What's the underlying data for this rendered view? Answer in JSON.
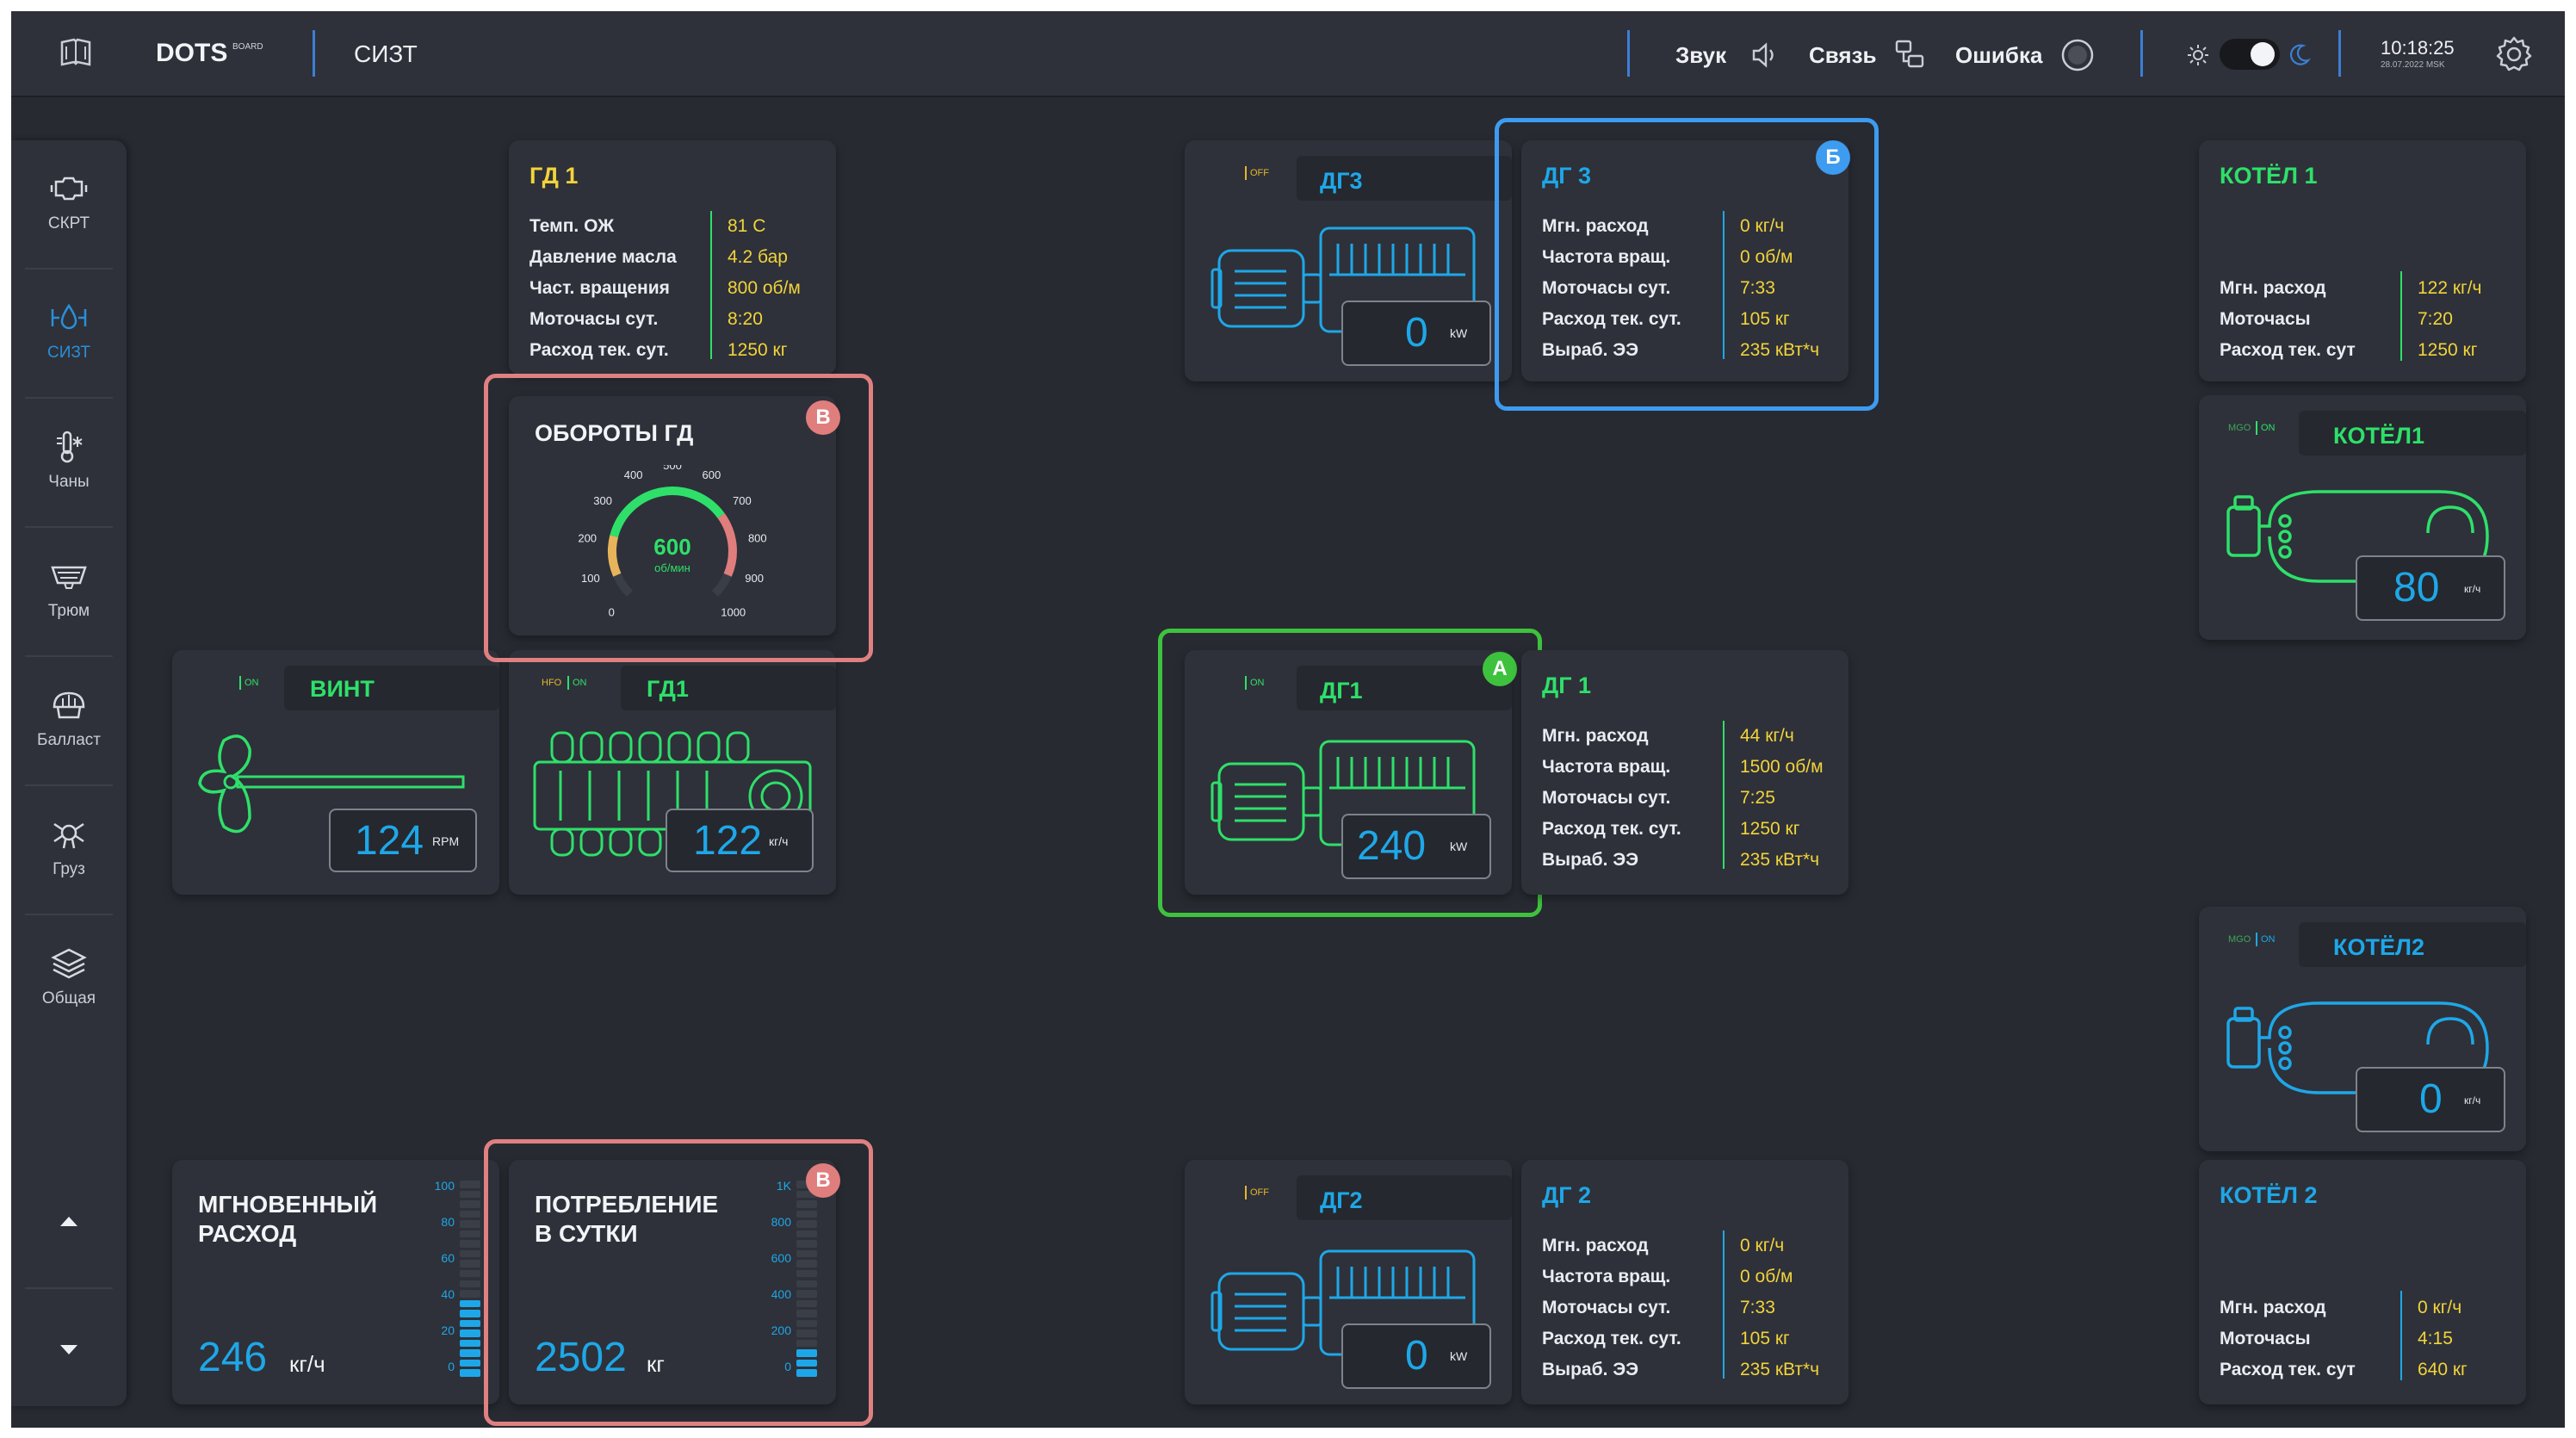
{
  "header": {
    "brand": "DOTS",
    "brand_sub": "BOARD",
    "section": "СИЗТ",
    "sound": "Звук",
    "link": "Связь",
    "error": "Ошибка",
    "time": "10:18:25",
    "date": "28.07.2022 MSK"
  },
  "sidebar": {
    "items": [
      {
        "label": "СКРТ",
        "icon": "engine-icon"
      },
      {
        "label": "СИЗТ",
        "icon": "fuel-system-icon"
      },
      {
        "label": "Чаны",
        "icon": "tank-temperature-icon"
      },
      {
        "label": "Трюм",
        "icon": "hold-icon"
      },
      {
        "label": "Балласт",
        "icon": "ballast-icon"
      },
      {
        "label": "Груз",
        "icon": "cargo-icon"
      },
      {
        "label": "Общая",
        "icon": "layers-icon"
      }
    ],
    "active_index": 1
  },
  "gd1_info": {
    "title": "ГД 1",
    "rows": [
      {
        "label": "Темп. ОЖ",
        "value": "81 C"
      },
      {
        "label": "Давление масла",
        "value": "4.2 бар"
      },
      {
        "label": "Част. вращения",
        "value": "800 об/м"
      },
      {
        "label": "Моточасы сут.",
        "value": "8:20"
      },
      {
        "label": "Расход тек. сут.",
        "value": "1250 кг"
      }
    ]
  },
  "gauge": {
    "title": "ОБОРОТЫ ГД",
    "value": "600",
    "unit": "об/мин",
    "badge": "В",
    "ticks": [
      "0",
      "100",
      "200",
      "300",
      "400",
      "500",
      "600",
      "700",
      "800",
      "900",
      "1000"
    ],
    "level": 0.6
  },
  "vint": {
    "status": "ON",
    "title": "ВИНТ",
    "value": "124",
    "unit": "RPM"
  },
  "gd1_engine": {
    "status1": "HFO",
    "status2": "ON",
    "title": "ГД1",
    "value": "122",
    "unit": "кг/ч"
  },
  "dg3_machine": {
    "status": "OFF",
    "title": "ДГ3",
    "value": "0",
    "unit": "kW"
  },
  "dg3_info": {
    "title": "ДГ 3",
    "badge": "Б",
    "rows": [
      {
        "label": "Мгн. расход",
        "value": "0 кг/ч"
      },
      {
        "label": "Частота вращ.",
        "value": "0 об/м"
      },
      {
        "label": "Моточасы сут.",
        "value": "7:33"
      },
      {
        "label": "Расход тек. сут.",
        "value": "105 кг"
      },
      {
        "label": "Выраб. ЭЭ",
        "value": "235 кВт*ч"
      }
    ]
  },
  "dg1_machine": {
    "status": "ON",
    "title": "ДГ1",
    "value": "240",
    "unit": "kW",
    "badge": "A"
  },
  "dg1_info": {
    "title": "ДГ 1",
    "rows": [
      {
        "label": "Мгн. расход",
        "value": "44 кг/ч"
      },
      {
        "label": "Частота вращ.",
        "value": "1500 об/м"
      },
      {
        "label": "Моточасы сут.",
        "value": "7:25"
      },
      {
        "label": "Расход тек. сут.",
        "value": "1250 кг"
      },
      {
        "label": "Выраб. ЭЭ",
        "value": "235 кВт*ч"
      }
    ]
  },
  "dg2_machine": {
    "status": "OFF",
    "title": "ДГ2",
    "value": "0",
    "unit": "kW"
  },
  "dg2_info": {
    "title": "ДГ 2",
    "rows": [
      {
        "label": "Мгн. расход",
        "value": "0 кг/ч"
      },
      {
        "label": "Частота вращ.",
        "value": "0 об/м"
      },
      {
        "label": "Моточасы сут.",
        "value": "7:33"
      },
      {
        "label": "Расход тек. сут.",
        "value": "105 кг"
      },
      {
        "label": "Выраб. ЭЭ",
        "value": "235 кВт*ч"
      }
    ]
  },
  "kotel1_info": {
    "title": "КОТЁЛ 1",
    "rows": [
      {
        "label": "Мгн. расход",
        "value": "122 кг/ч"
      },
      {
        "label": "Моточасы",
        "value": "7:20"
      },
      {
        "label": "Расход тек. сут",
        "value": "1250 кг"
      }
    ]
  },
  "kotel1_machine": {
    "status1": "MGO",
    "status2": "ON",
    "title": "КОТЁЛ1",
    "value": "80",
    "unit": "кг/ч"
  },
  "kotel2_machine": {
    "status1": "MGO",
    "status2": "ON",
    "title": "КОТЁЛ2",
    "value": "0",
    "unit": "кг/ч"
  },
  "kotel2_info": {
    "title": "КОТЁЛ 2",
    "rows": [
      {
        "label": "Мгн. расход",
        "value": "0 кг/ч"
      },
      {
        "label": "Моточасы",
        "value": "4:15"
      },
      {
        "label": "Расход тек. сут",
        "value": "640 кг"
      }
    ]
  },
  "instant": {
    "title_line1": "МГНОВЕННЫЙ",
    "title_line2": "РАСХОД",
    "value": "246",
    "unit": "кг/ч",
    "scale": [
      "100",
      "80",
      "60",
      "40",
      "20",
      "0"
    ],
    "level": 0.4
  },
  "daily": {
    "title_line1": "ПОТРЕБЛЕНИЕ",
    "title_line2": "В СУТКИ",
    "value": "2502",
    "unit": "кг",
    "badge": "В",
    "scale": [
      "1K",
      "800",
      "600",
      "400",
      "200",
      "0"
    ],
    "level": 0.15
  },
  "colors": {
    "green": "#2ee06a",
    "cyan": "#1ea7e8",
    "blue_outline": "#3d9bf0",
    "red_outline": "#e08080",
    "green_outline": "#3ec23e",
    "info_value": "#f2d33b"
  }
}
